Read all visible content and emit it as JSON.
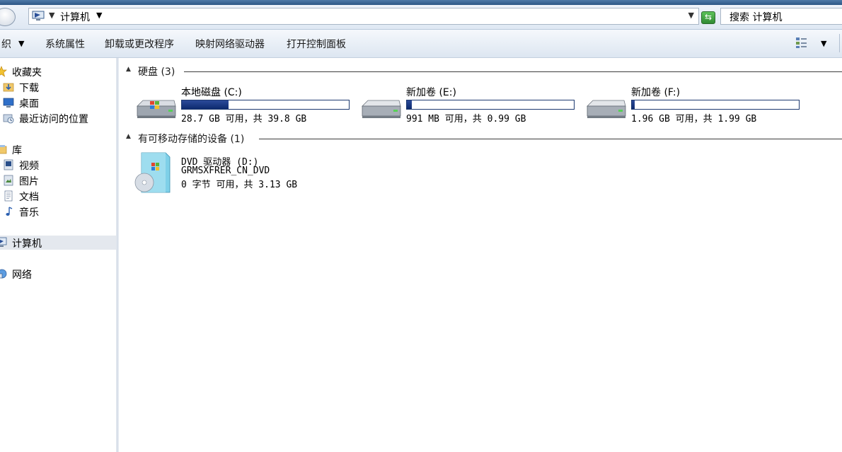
{
  "window": {
    "address": {
      "path_label": "计算机",
      "search_placeholder": "搜索 计算机"
    }
  },
  "toolbar": {
    "organize_label": "织",
    "system_properties_label": "系统属性",
    "uninstall_label": "卸载或更改程序",
    "map_drive_label": "映射网络驱动器",
    "control_panel_label": "打开控制面板"
  },
  "nav": {
    "favorites": "收藏夹",
    "downloads": "下载",
    "desktop": "桌面",
    "recent": "最近访问的位置",
    "libraries": "库",
    "videos": "视频",
    "pictures": "图片",
    "documents": "文档",
    "music": "音乐",
    "computer": "计算机",
    "network": "网络"
  },
  "groups": {
    "hard_disks": {
      "title": "硬盘 (3)",
      "drives": [
        {
          "name": "本地磁盘 (C:)",
          "free_text": "28.7 GB 可用，共 39.8 GB",
          "used_fraction": 0.28
        },
        {
          "name": "新加卷 (E:)",
          "free_text": "991 MB 可用，共 0.99 GB",
          "used_fraction": 0.03
        },
        {
          "name": "新加卷 (F:)",
          "free_text": "1.96 GB 可用，共 1.99 GB",
          "used_fraction": 0.015
        }
      ]
    },
    "removable": {
      "title": "有可移动存储的设备 (1)",
      "devices": [
        {
          "name": "DVD 驱动器 (D:)",
          "label": "GRMSXFRER_CN_DVD",
          "free_text": "0 字节 可用，共 3.13 GB"
        }
      ]
    }
  },
  "colors": {
    "bar_fill": "#173a85",
    "bar_border": "#1e3a70",
    "selected_nav": "#e4e8ee"
  }
}
